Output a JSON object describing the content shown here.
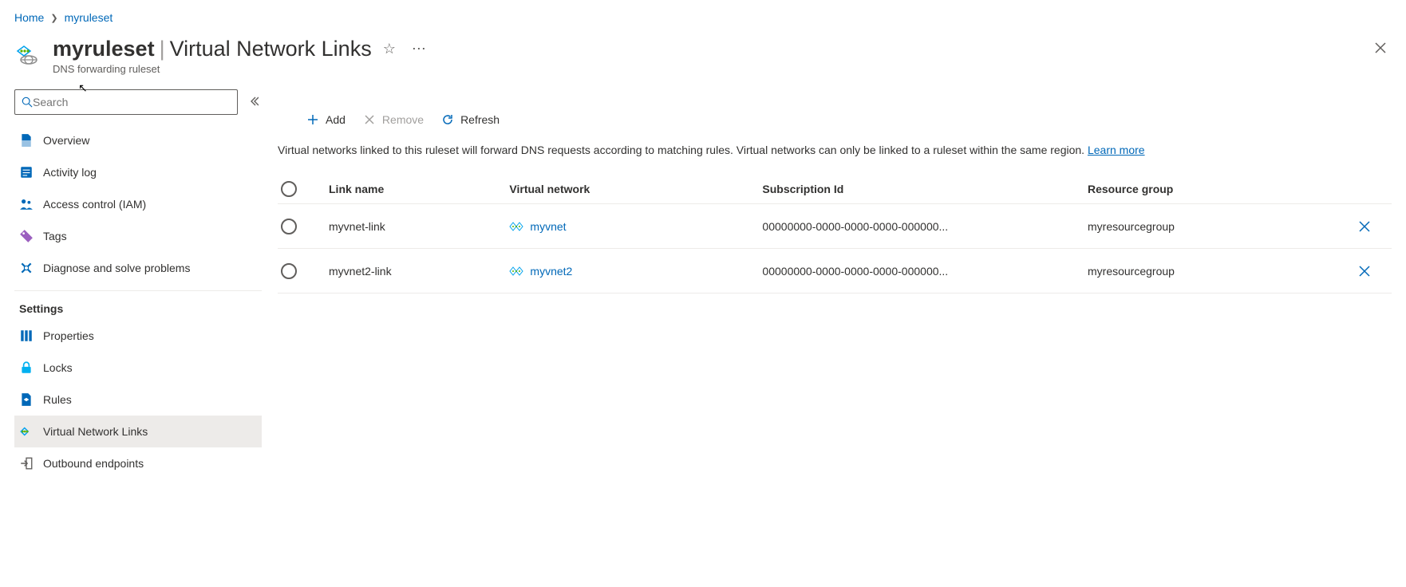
{
  "breadcrumb": {
    "home": "Home",
    "item": "myruleset"
  },
  "header": {
    "resource_name": "myruleset",
    "section": "Virtual Network Links",
    "resource_type": "DNS forwarding ruleset"
  },
  "search": {
    "placeholder": "Search"
  },
  "sidebar": {
    "items": {
      "overview": "Overview",
      "activity_log": "Activity log",
      "access_control": "Access control (IAM)",
      "tags": "Tags",
      "diagnose": "Diagnose and solve problems"
    },
    "settings_heading": "Settings",
    "settings": {
      "properties": "Properties",
      "locks": "Locks",
      "rules": "Rules",
      "vnet_links": "Virtual Network Links",
      "outbound_endpoints": "Outbound endpoints"
    }
  },
  "toolbar": {
    "add": "Add",
    "remove": "Remove",
    "refresh": "Refresh"
  },
  "description": {
    "text": "Virtual networks linked to this ruleset will forward DNS requests according to matching rules. Virtual networks can only be linked to a ruleset within the same region. ",
    "learn_more": "Learn more"
  },
  "table": {
    "headers": {
      "link_name": "Link name",
      "virtual_network": "Virtual network",
      "subscription_id": "Subscription Id",
      "resource_group": "Resource group"
    },
    "rows": [
      {
        "link_name": "myvnet-link",
        "virtual_network": "myvnet",
        "subscription_id": "00000000-0000-0000-0000-000000...",
        "resource_group": "myresourcegroup"
      },
      {
        "link_name": "myvnet2-link",
        "virtual_network": "myvnet2",
        "subscription_id": "00000000-0000-0000-0000-000000...",
        "resource_group": "myresourcegroup"
      }
    ]
  }
}
